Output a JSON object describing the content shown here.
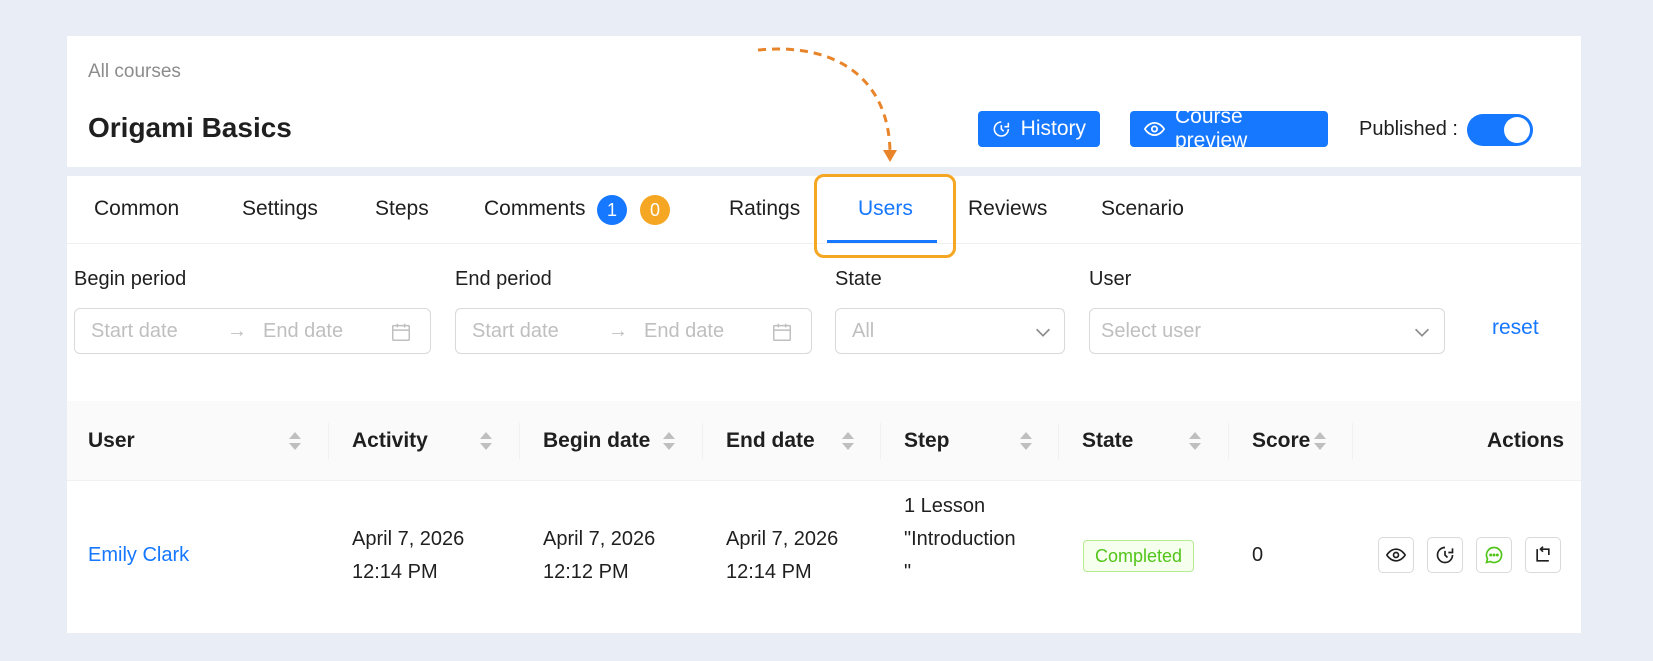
{
  "breadcrumb": "All courses",
  "title": "Origami Basics",
  "header": {
    "history_label": "History",
    "preview_label": "Course preview",
    "published_label": "Published",
    "published_on": true
  },
  "tabs": [
    {
      "label": "Common"
    },
    {
      "label": "Settings"
    },
    {
      "label": "Steps"
    },
    {
      "label": "Comments"
    },
    {
      "label": "Ratings"
    },
    {
      "label": "Users"
    },
    {
      "label": "Reviews"
    },
    {
      "label": "Scenario"
    }
  ],
  "active_tab": "Users",
  "comment_badges": [
    "1",
    "0"
  ],
  "filters": {
    "begin_period": {
      "label": "Begin period",
      "start_placeholder": "Start date",
      "end_placeholder": "End date"
    },
    "end_period": {
      "label": "End period",
      "start_placeholder": "Start date",
      "end_placeholder": "End date"
    },
    "state": {
      "label": "State",
      "value": "All"
    },
    "user": {
      "label": "User",
      "placeholder": "Select user"
    },
    "reset_label": "reset"
  },
  "table": {
    "columns": [
      "User",
      "Activity",
      "Begin date",
      "End date",
      "Step",
      "State",
      "Score",
      "Actions"
    ],
    "rows": [
      {
        "user": "Emily Clark",
        "activity_date": "April 7, 2026",
        "activity_time": "12:14 PM",
        "begin_date": "April 7, 2026",
        "begin_time": "12:12 PM",
        "end_date": "April 7, 2026",
        "end_time": "12:14 PM",
        "step_line1": "1 Lesson",
        "step_line2": "\"Introduction",
        "step_line3": "\"",
        "state": "Completed",
        "score": "0"
      }
    ]
  },
  "colors": {
    "accent": "#1677ff",
    "highlight": "#f5a623",
    "success": "#52c41a"
  }
}
